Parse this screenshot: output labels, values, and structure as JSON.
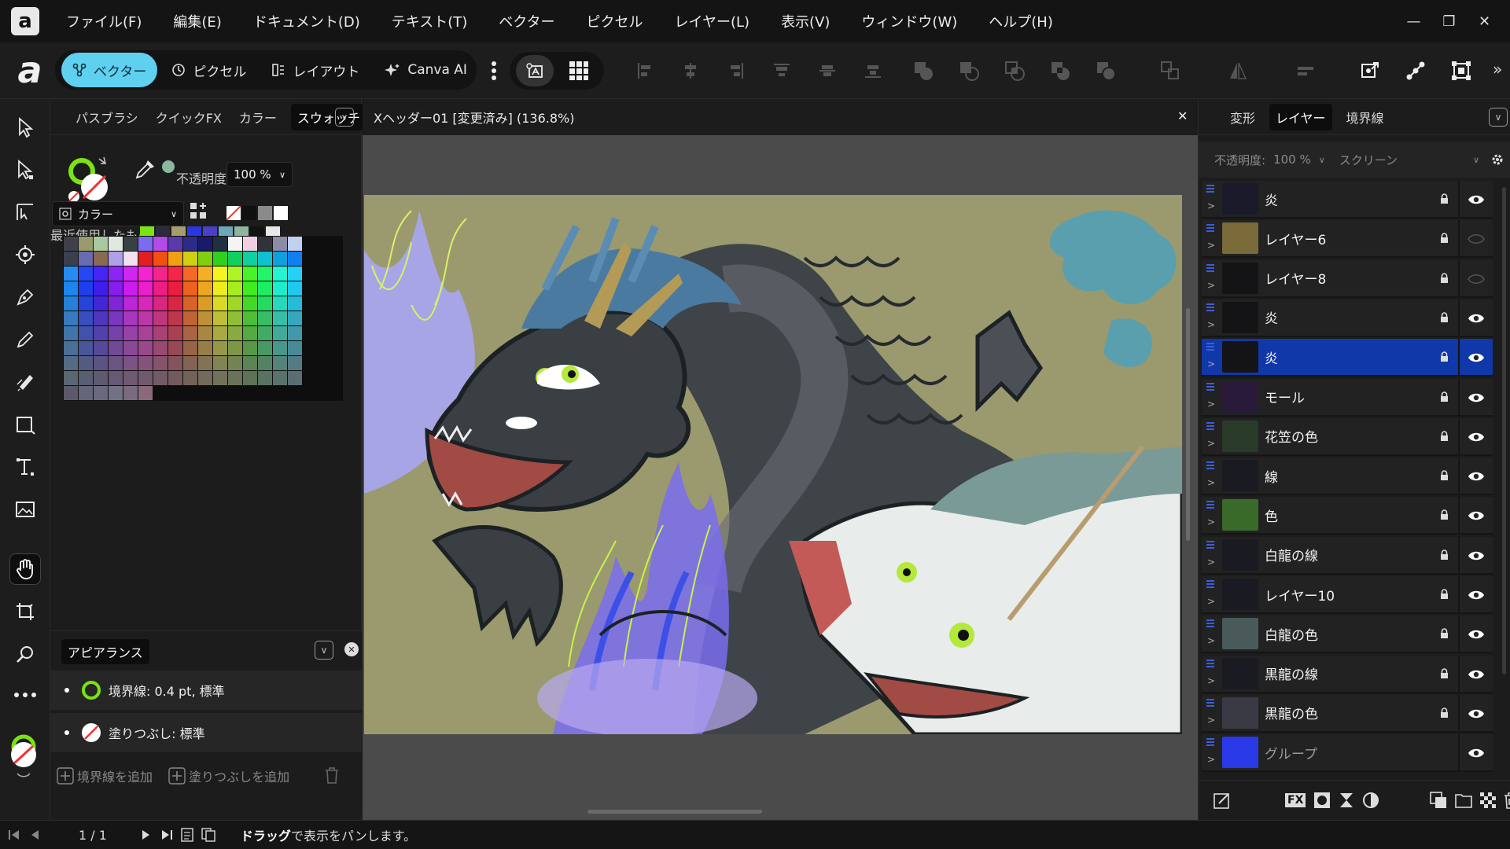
{
  "app": {
    "logo_letter": "a"
  },
  "menu": [
    "ファイル(F)",
    "編集(E)",
    "ドキュメント(D)",
    "テキスト(T)",
    "ベクター",
    "ピクセル",
    "レイヤー(L)",
    "表示(V)",
    "ウィンドウ(W)",
    "ヘルプ(H)"
  ],
  "window_controls": {
    "minimize": "—",
    "restore": "❐",
    "close": "✕"
  },
  "toolbar": {
    "brand": "a",
    "personas": [
      {
        "label": "ベクター",
        "active": true
      },
      {
        "label": "ピクセル",
        "active": false
      },
      {
        "label": "レイアウト",
        "active": false
      },
      {
        "label": "Canva AI",
        "active": false
      }
    ],
    "more": "»"
  },
  "left_panel": {
    "tabs": [
      "パスブラシ",
      "クイックFX",
      "カラー",
      "スウォッチ"
    ],
    "active_tab": "スウォッチ",
    "opacity_label": "不透明度:",
    "opacity_value": "100 %",
    "recent_label": "最近使用したもの:",
    "recent_colors": [
      "#7be312",
      "#2b2b3c",
      "#a79c6e",
      "#2b35e0",
      "#4a3fc8",
      "#6aa7b8",
      "#8db69e",
      "#131313",
      "#e8e8e8"
    ],
    "palette_dropdown": "カラー",
    "mini_swatches": [
      "none",
      "#101010",
      "#8a8a8a",
      "#ffffff"
    ]
  },
  "appearance": {
    "title": "アピアランス",
    "stroke_row": "境界線: 0.4 pt,  標準",
    "fill_row": "塗りつぶし:  標準",
    "add_stroke": "境界線を追加",
    "add_fill": "塗りつぶしを追加"
  },
  "document": {
    "title": "Xヘッダー01 [変更済み] (136.8%)",
    "close": "✕"
  },
  "right_panel": {
    "tabs": [
      "変形",
      "レイヤー",
      "境界線"
    ],
    "active_tab": "レイヤー",
    "opacity_label": "不透明度:",
    "opacity_value": "100 %",
    "blend_mode": "スクリーン",
    "layers": [
      {
        "name": "炎",
        "visible": true,
        "locked": true,
        "selected": false
      },
      {
        "name": "レイヤー6",
        "visible": false,
        "locked": true,
        "selected": false
      },
      {
        "name": "レイヤー8",
        "visible": false,
        "locked": true,
        "selected": false
      },
      {
        "name": "炎",
        "visible": true,
        "locked": true,
        "selected": false
      },
      {
        "name": "炎",
        "visible": true,
        "locked": true,
        "selected": true
      },
      {
        "name": "モール",
        "visible": true,
        "locked": true,
        "selected": false
      },
      {
        "name": "花笠の色",
        "visible": true,
        "locked": true,
        "selected": false
      },
      {
        "name": "線",
        "visible": true,
        "locked": true,
        "selected": false
      },
      {
        "name": "色",
        "visible": true,
        "locked": true,
        "selected": false
      },
      {
        "name": "白龍の線",
        "visible": true,
        "locked": true,
        "selected": false
      },
      {
        "name": "レイヤー10",
        "visible": true,
        "locked": true,
        "selected": false
      },
      {
        "name": "白龍の色",
        "visible": true,
        "locked": true,
        "selected": false
      },
      {
        "name": "黒龍の線",
        "visible": true,
        "locked": true,
        "selected": false
      },
      {
        "name": "黒龍の色",
        "visible": true,
        "locked": true,
        "selected": false
      },
      {
        "name": "グループ",
        "visible": true,
        "locked": false,
        "selected": false
      }
    ],
    "bottom_fx": "FX"
  },
  "status": {
    "page": "1 / 1",
    "hint_bold": "ドラッグ",
    "hint_rest": "で表示をパンします。"
  }
}
